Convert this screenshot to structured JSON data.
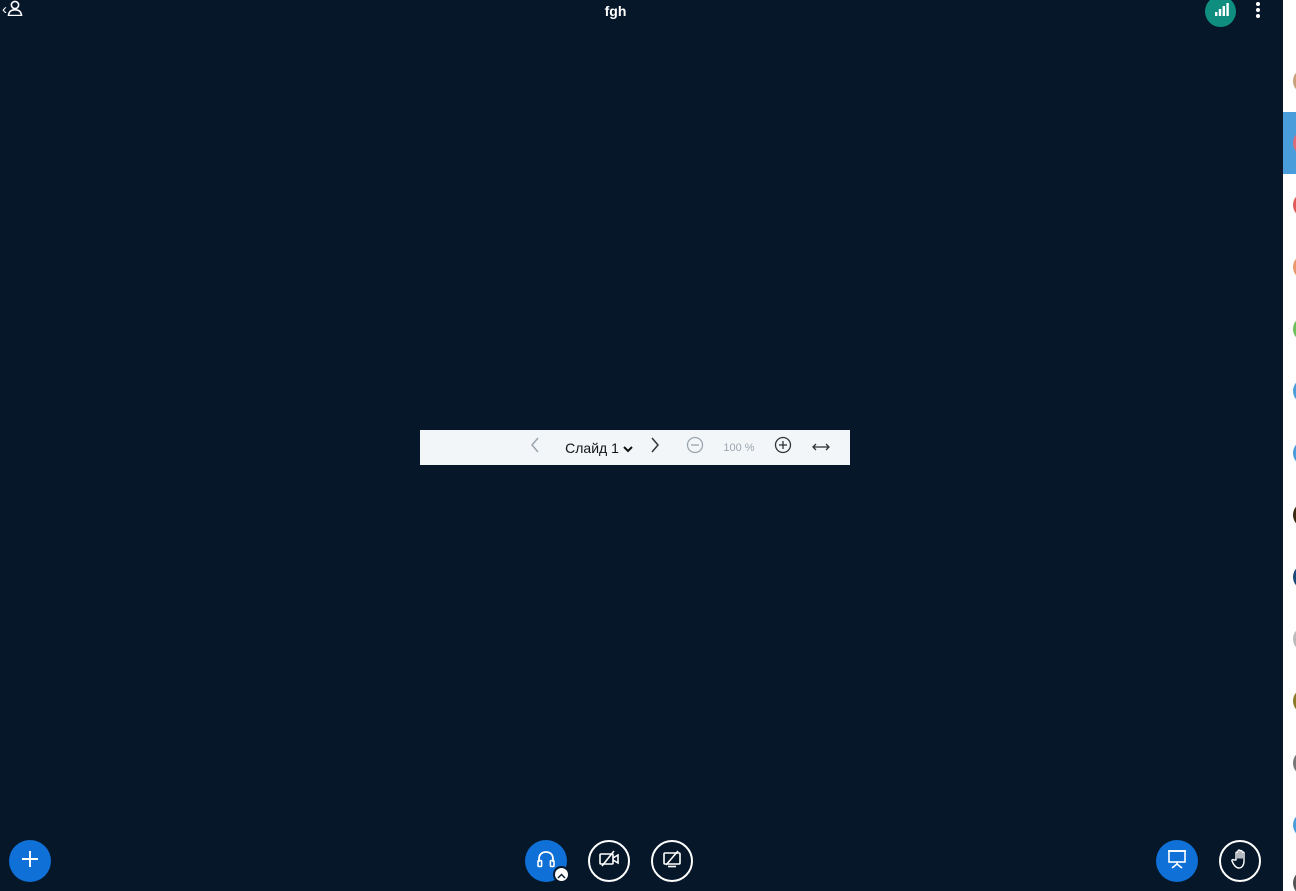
{
  "header": {
    "meeting_title": "fgh",
    "icons": {
      "back": "chevron-left-icon",
      "users": "user-icon",
      "connection": "signal-bars-icon",
      "more": "more-vertical-icon"
    },
    "colors": {
      "background": "#06172A",
      "connection_ok": "#0F8E80"
    }
  },
  "presentation_toolbar": {
    "slide_label": "Слайд 1",
    "zoom_label": "100 %",
    "icons": {
      "prev": "chevron-left-icon",
      "next": "chevron-right-icon",
      "slide_dropdown": "chevron-down-icon",
      "zoom_out": "zoom-out-icon",
      "zoom_in": "zoom-in-icon",
      "fit_width": "fit-width-icon"
    }
  },
  "bottom_bar": {
    "icons": {
      "actions": "plus-icon",
      "audio": "headphones-icon",
      "audio_options": "chevron-up-icon",
      "camera": "camera-off-icon",
      "screen_share": "screen-share-off-icon",
      "presentation": "presentation-icon",
      "raise_hand": "hand-icon"
    },
    "colors": {
      "primary": "#0F70D7"
    }
  },
  "sidebar": {
    "avatar_colors": [
      "#C8A07A",
      "#E06A7A",
      "#E05A5A",
      "#E89A6A",
      "#6CC05A",
      "#4A9DDB",
      "#4A9DDB",
      "#3A2A10",
      "#1A4A7A",
      "#BBBBBB",
      "#8A7A2A",
      "#777777",
      "#4A9DDB",
      "#555555"
    ],
    "active_color": "#4A9DDB"
  }
}
